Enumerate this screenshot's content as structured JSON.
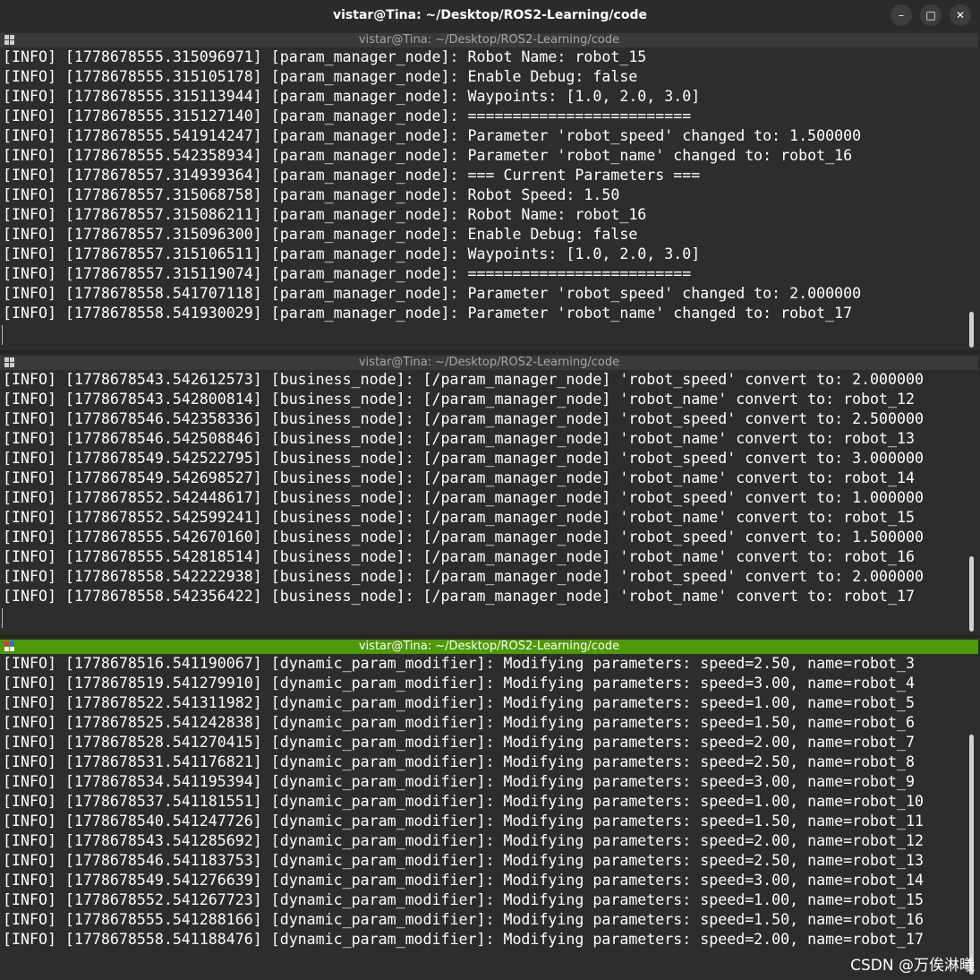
{
  "window": {
    "title": "vistar@Tina: ~/Desktop/ROS2-Learning/code",
    "minimize_glyph": "–",
    "maximize_glyph": "□",
    "close_glyph": "✕"
  },
  "panes": [
    {
      "title": "vistar@Tina: ~/Desktop/ROS2-Learning/code",
      "active": false,
      "lines": [
        "[INFO] [1778678555.315096971] [param_manager_node]: Robot Name: robot_15",
        "[INFO] [1778678555.315105178] [param_manager_node]: Enable Debug: false",
        "[INFO] [1778678555.315113944] [param_manager_node]: Waypoints: [1.0, 2.0, 3.0]",
        "[INFO] [1778678555.315127140] [param_manager_node]: =========================",
        "[INFO] [1778678555.541914247] [param_manager_node]: Parameter 'robot_speed' changed to: 1.500000",
        "[INFO] [1778678555.542358934] [param_manager_node]: Parameter 'robot_name' changed to: robot_16",
        "[INFO] [1778678557.314939364] [param_manager_node]: === Current Parameters ===",
        "[INFO] [1778678557.315068758] [param_manager_node]: Robot Speed: 1.50",
        "[INFO] [1778678557.315086211] [param_manager_node]: Robot Name: robot_16",
        "[INFO] [1778678557.315096300] [param_manager_node]: Enable Debug: false",
        "[INFO] [1778678557.315106511] [param_manager_node]: Waypoints: [1.0, 2.0, 3.0]",
        "[INFO] [1778678557.315119074] [param_manager_node]: =========================",
        "[INFO] [1778678558.541707118] [param_manager_node]: Parameter 'robot_speed' changed to: 2.000000",
        "[INFO] [1778678558.541930029] [param_manager_node]: Parameter 'robot_name' changed to: robot_17"
      ]
    },
    {
      "title": "vistar@Tina: ~/Desktop/ROS2-Learning/code",
      "active": false,
      "lines": [
        "[INFO] [1778678543.542612573] [business_node]: [/param_manager_node] 'robot_speed' convert to: 2.000000",
        "[INFO] [1778678543.542800814] [business_node]: [/param_manager_node] 'robot_name' convert to: robot_12",
        "[INFO] [1778678546.542358336] [business_node]: [/param_manager_node] 'robot_speed' convert to: 2.500000",
        "[INFO] [1778678546.542508846] [business_node]: [/param_manager_node] 'robot_name' convert to: robot_13",
        "[INFO] [1778678549.542522795] [business_node]: [/param_manager_node] 'robot_speed' convert to: 3.000000",
        "[INFO] [1778678549.542698527] [business_node]: [/param_manager_node] 'robot_name' convert to: robot_14",
        "[INFO] [1778678552.542448617] [business_node]: [/param_manager_node] 'robot_speed' convert to: 1.000000",
        "[INFO] [1778678552.542599241] [business_node]: [/param_manager_node] 'robot_name' convert to: robot_15",
        "[INFO] [1778678555.542670160] [business_node]: [/param_manager_node] 'robot_speed' convert to: 1.500000",
        "[INFO] [1778678555.542818514] [business_node]: [/param_manager_node] 'robot_name' convert to: robot_16",
        "[INFO] [1778678558.542222938] [business_node]: [/param_manager_node] 'robot_speed' convert to: 2.000000",
        "[INFO] [1778678558.542356422] [business_node]: [/param_manager_node] 'robot_name' convert to: robot_17"
      ]
    },
    {
      "title": "vistar@Tina: ~/Desktop/ROS2-Learning/code",
      "active": true,
      "lines": [
        "[INFO] [1778678516.541190067] [dynamic_param_modifier]: Modifying parameters: speed=2.50, name=robot_3",
        "[INFO] [1778678519.541279910] [dynamic_param_modifier]: Modifying parameters: speed=3.00, name=robot_4",
        "[INFO] [1778678522.541311982] [dynamic_param_modifier]: Modifying parameters: speed=1.00, name=robot_5",
        "[INFO] [1778678525.541242838] [dynamic_param_modifier]: Modifying parameters: speed=1.50, name=robot_6",
        "[INFO] [1778678528.541270415] [dynamic_param_modifier]: Modifying parameters: speed=2.00, name=robot_7",
        "[INFO] [1778678531.541176821] [dynamic_param_modifier]: Modifying parameters: speed=2.50, name=robot_8",
        "[INFO] [1778678534.541195394] [dynamic_param_modifier]: Modifying parameters: speed=3.00, name=robot_9",
        "[INFO] [1778678537.541181551] [dynamic_param_modifier]: Modifying parameters: speed=1.00, name=robot_10",
        "[INFO] [1778678540.541247726] [dynamic_param_modifier]: Modifying parameters: speed=1.50, name=robot_11",
        "[INFO] [1778678543.541285692] [dynamic_param_modifier]: Modifying parameters: speed=2.00, name=robot_12",
        "[INFO] [1778678546.541183753] [dynamic_param_modifier]: Modifying parameters: speed=2.50, name=robot_13",
        "[INFO] [1778678549.541276639] [dynamic_param_modifier]: Modifying parameters: speed=3.00, name=robot_14",
        "[INFO] [1778678552.541267723] [dynamic_param_modifier]: Modifying parameters: speed=1.00, name=robot_15",
        "[INFO] [1778678555.541288166] [dynamic_param_modifier]: Modifying parameters: speed=1.50, name=robot_16",
        "[INFO] [1778678558.541188476] [dynamic_param_modifier]: Modifying parameters: speed=2.00, name=robot_17"
      ]
    }
  ],
  "watermark": "CSDN @万俟淋曦",
  "colors": {
    "active_header": "#4e9a06",
    "terminal_bg": "#2d2d2d",
    "text": "#ffffff"
  }
}
